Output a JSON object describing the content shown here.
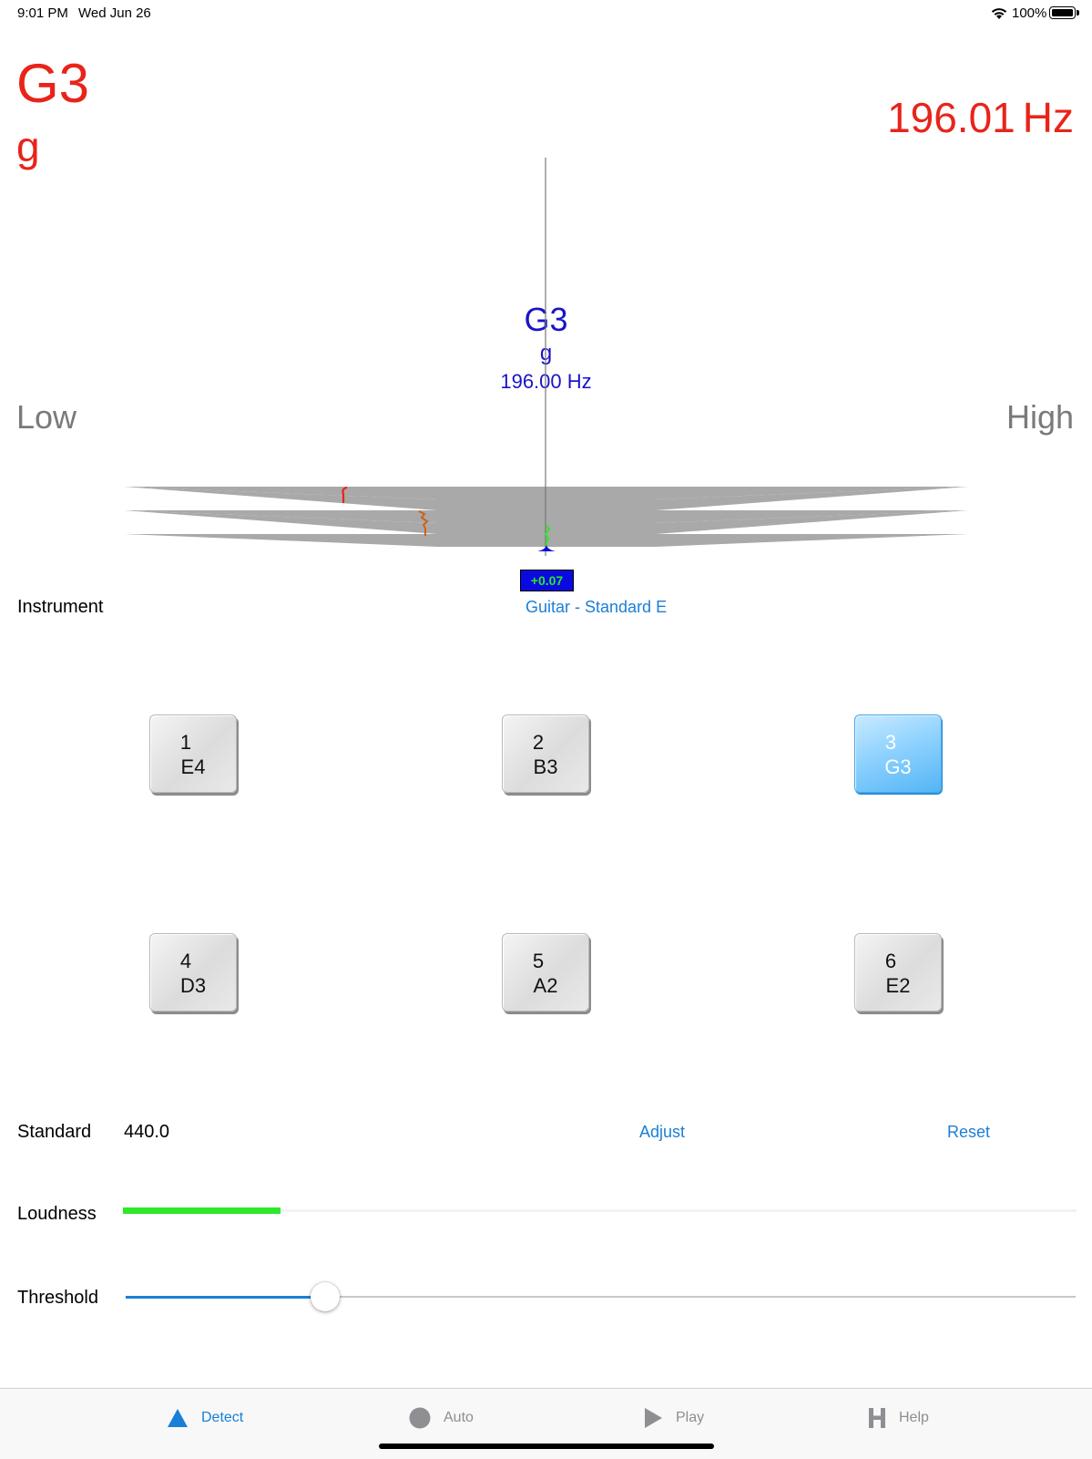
{
  "status_bar": {
    "time": "9:01 PM",
    "date": "Wed Jun 26",
    "battery": "100%"
  },
  "detected": {
    "note": "G3",
    "solfege": "g",
    "frequency": "196.01",
    "unit": "Hz"
  },
  "target": {
    "note": "G3",
    "solfege": "g",
    "frequency": "196.00 Hz"
  },
  "meter": {
    "low_label": "Low",
    "high_label": "High",
    "deviation": "+0.07"
  },
  "instrument": {
    "label": "Instrument",
    "value": "Guitar - Standard E"
  },
  "strings": [
    {
      "number": "1",
      "note": "E4",
      "active": false
    },
    {
      "number": "2",
      "note": "B3",
      "active": false
    },
    {
      "number": "3",
      "note": "G3",
      "active": true
    },
    {
      "number": "4",
      "note": "D3",
      "active": false
    },
    {
      "number": "5",
      "note": "A2",
      "active": false
    },
    {
      "number": "6",
      "note": "E2",
      "active": false
    }
  ],
  "standard": {
    "label": "Standard",
    "value": "440.0",
    "adjust": "Adjust",
    "reset": "Reset"
  },
  "loudness": {
    "label": "Loudness",
    "level": 0.165
  },
  "threshold": {
    "label": "Threshold",
    "level": 0.21
  },
  "tabs": [
    {
      "label": "Detect",
      "icon": "triangle-icon",
      "active": true
    },
    {
      "label": "Auto",
      "icon": "circle-icon",
      "active": false
    },
    {
      "label": "Play",
      "icon": "play-icon",
      "active": false
    },
    {
      "label": "Help",
      "icon": "h-icon",
      "active": false
    }
  ],
  "colors": {
    "detected": "#e8241a",
    "target": "#1a14c8",
    "accent": "#1a7fd6",
    "loudness": "#2ee82a",
    "deviation_box": "#0a0ae0",
    "meter": "#a9a9a9"
  }
}
